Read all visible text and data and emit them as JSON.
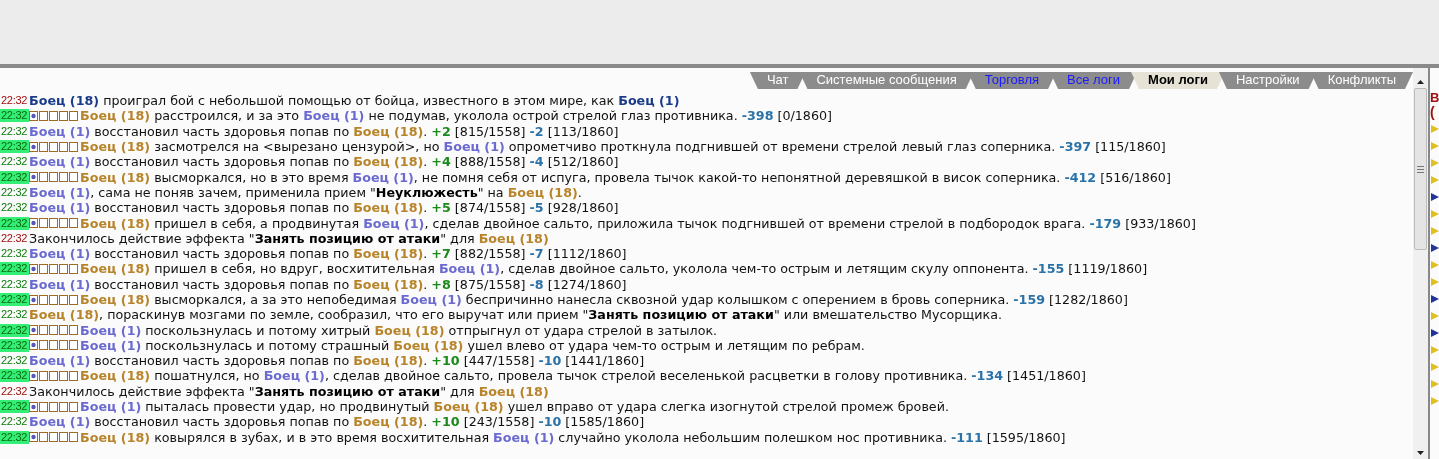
{
  "tabs": [
    {
      "label": "Чат",
      "selected": false,
      "highlighted": false
    },
    {
      "label": "Системные сообщения",
      "selected": false,
      "highlighted": false
    },
    {
      "label": "Торговля",
      "selected": false,
      "highlighted": true
    },
    {
      "label": "Все логи",
      "selected": false,
      "highlighted": true
    },
    {
      "label": "Мои логи",
      "selected": true,
      "highlighted": false
    },
    {
      "label": "Настройки",
      "selected": false,
      "highlighted": false
    },
    {
      "label": "Конфликты",
      "selected": false,
      "highlighted": false
    }
  ],
  "log": [
    {
      "time": "22:32",
      "kind": "system",
      "parts": [
        {
          "kind": "winner",
          "text": "Боец (18)"
        },
        {
          "kind": "text",
          "text": " проиграл бой с небольшой помощью от бойца, известного в этом мире, как "
        },
        {
          "kind": "winner",
          "text": "Боец (1)"
        }
      ]
    },
    {
      "time": "22:32",
      "kind": "attack",
      "parts": [
        {
          "kind": "fighter2",
          "text": "Боец (18)"
        },
        {
          "kind": "text",
          "text": " расстроился, и за это "
        },
        {
          "kind": "fighter1",
          "text": "Боец (1)"
        },
        {
          "kind": "text",
          "text": " не подумав, уколола острой стрелой глаз противника. "
        },
        {
          "kind": "damage",
          "text": "-398"
        },
        {
          "kind": "text",
          "text": " [0/1860]"
        }
      ]
    },
    {
      "time": "22:32",
      "kind": "normal",
      "parts": [
        {
          "kind": "fighter1",
          "text": "Боец (1)"
        },
        {
          "kind": "text",
          "text": " восстановил часть здоровья попав по "
        },
        {
          "kind": "fighter2",
          "text": "Боец (18)"
        },
        {
          "kind": "text",
          "text": ". "
        },
        {
          "kind": "heal",
          "text": "+2"
        },
        {
          "kind": "text",
          "text": " [815/1558] "
        },
        {
          "kind": "damage",
          "text": "-2"
        },
        {
          "kind": "text",
          "text": " [113/1860]"
        }
      ]
    },
    {
      "time": "22:32",
      "kind": "attack",
      "parts": [
        {
          "kind": "fighter2",
          "text": "Боец (18)"
        },
        {
          "kind": "text",
          "text": " засмотрелся на <вырезано цензурой>, но "
        },
        {
          "kind": "fighter1",
          "text": "Боец (1)"
        },
        {
          "kind": "text",
          "text": " опрометчиво проткнула подгнившей от времени стрелой левый глаз соперника. "
        },
        {
          "kind": "damage",
          "text": "-397"
        },
        {
          "kind": "text",
          "text": " [115/1860]"
        }
      ]
    },
    {
      "time": "22:32",
      "kind": "normal",
      "parts": [
        {
          "kind": "fighter1",
          "text": "Боец (1)"
        },
        {
          "kind": "text",
          "text": " восстановил часть здоровья попав по "
        },
        {
          "kind": "fighter2",
          "text": "Боец (18)"
        },
        {
          "kind": "text",
          "text": ". "
        },
        {
          "kind": "heal",
          "text": "+4"
        },
        {
          "kind": "text",
          "text": " [888/1558] "
        },
        {
          "kind": "damage",
          "text": "-4"
        },
        {
          "kind": "text",
          "text": " [512/1860]"
        }
      ]
    },
    {
      "time": "22:32",
      "kind": "attack",
      "parts": [
        {
          "kind": "fighter2",
          "text": "Боец (18)"
        },
        {
          "kind": "text",
          "text": " высморкался, но в это время "
        },
        {
          "kind": "fighter1",
          "text": "Боец (1)"
        },
        {
          "kind": "text",
          "text": ", не помня себя от испуга, провела тычок какой-то непонятной деревяшкой в висок соперника. "
        },
        {
          "kind": "damage",
          "text": "-412"
        },
        {
          "kind": "text",
          "text": " [516/1860]"
        }
      ]
    },
    {
      "time": "22:32",
      "kind": "normal",
      "parts": [
        {
          "kind": "fighter1",
          "text": "Боец (1)"
        },
        {
          "kind": "text",
          "text": ", сама не поняв зачем, применила прием \""
        },
        {
          "kind": "emph",
          "text": "Неуклюжесть"
        },
        {
          "kind": "text",
          "text": "\" на "
        },
        {
          "kind": "fighter2",
          "text": "Боец (18)"
        },
        {
          "kind": "text",
          "text": "."
        }
      ]
    },
    {
      "time": "22:32",
      "kind": "normal",
      "parts": [
        {
          "kind": "fighter1",
          "text": "Боец (1)"
        },
        {
          "kind": "text",
          "text": " восстановил часть здоровья попав по "
        },
        {
          "kind": "fighter2",
          "text": "Боец (18)"
        },
        {
          "kind": "text",
          "text": ". "
        },
        {
          "kind": "heal",
          "text": "+5"
        },
        {
          "kind": "text",
          "text": " [874/1558] "
        },
        {
          "kind": "damage",
          "text": "-5"
        },
        {
          "kind": "text",
          "text": " [928/1860]"
        }
      ]
    },
    {
      "time": "22:32",
      "kind": "attack",
      "parts": [
        {
          "kind": "fighter2",
          "text": "Боец (18)"
        },
        {
          "kind": "text",
          "text": " пришел в себя, а продвинутая "
        },
        {
          "kind": "fighter1",
          "text": "Боец (1)"
        },
        {
          "kind": "text",
          "text": ", сделав двойное сальто, приложила тычок подгнившей от времени стрелой в подбородок врага. "
        },
        {
          "kind": "damage",
          "text": "-179"
        },
        {
          "kind": "text",
          "text": " [933/1860]"
        }
      ]
    },
    {
      "time": "22:32",
      "kind": "system",
      "parts": [
        {
          "kind": "text",
          "text": "Закончилось действие эффекта \""
        },
        {
          "kind": "emph",
          "text": "Занять позицию от атаки"
        },
        {
          "kind": "text",
          "text": "\" для "
        },
        {
          "kind": "fighter2",
          "text": "Боец (18)"
        }
      ]
    },
    {
      "time": "22:32",
      "kind": "normal",
      "parts": [
        {
          "kind": "fighter1",
          "text": "Боец (1)"
        },
        {
          "kind": "text",
          "text": " восстановил часть здоровья попав по "
        },
        {
          "kind": "fighter2",
          "text": "Боец (18)"
        },
        {
          "kind": "text",
          "text": ". "
        },
        {
          "kind": "heal",
          "text": "+7"
        },
        {
          "kind": "text",
          "text": " [882/1558] "
        },
        {
          "kind": "damage",
          "text": "-7"
        },
        {
          "kind": "text",
          "text": " [1112/1860]"
        }
      ]
    },
    {
      "time": "22:32",
      "kind": "attack",
      "parts": [
        {
          "kind": "fighter2",
          "text": "Боец (18)"
        },
        {
          "kind": "text",
          "text": " пришел в себя, но вдруг, восхитительная "
        },
        {
          "kind": "fighter1",
          "text": "Боец (1)"
        },
        {
          "kind": "text",
          "text": ", сделав двойное сальто, уколола чем-то острым и летящим скулу оппонента. "
        },
        {
          "kind": "damage",
          "text": "-155"
        },
        {
          "kind": "text",
          "text": " [1119/1860]"
        }
      ]
    },
    {
      "time": "22:32",
      "kind": "normal",
      "parts": [
        {
          "kind": "fighter1",
          "text": "Боец (1)"
        },
        {
          "kind": "text",
          "text": " восстановил часть здоровья попав по "
        },
        {
          "kind": "fighter2",
          "text": "Боец (18)"
        },
        {
          "kind": "text",
          "text": ". "
        },
        {
          "kind": "heal",
          "text": "+8"
        },
        {
          "kind": "text",
          "text": " [875/1558] "
        },
        {
          "kind": "damage",
          "text": "-8"
        },
        {
          "kind": "text",
          "text": " [1274/1860]"
        }
      ]
    },
    {
      "time": "22:32",
      "kind": "attack",
      "parts": [
        {
          "kind": "fighter2",
          "text": "Боец (18)"
        },
        {
          "kind": "text",
          "text": " высморкался, а за это непобедимая "
        },
        {
          "kind": "fighter1",
          "text": "Боец (1)"
        },
        {
          "kind": "text",
          "text": " беспричинно нанесла сквозной удар колышком с оперением в бровь соперника. "
        },
        {
          "kind": "damage",
          "text": "-159"
        },
        {
          "kind": "text",
          "text": " [1282/1860]"
        }
      ]
    },
    {
      "time": "22:32",
      "kind": "normal",
      "parts": [
        {
          "kind": "fighter2",
          "text": "Боец (18)"
        },
        {
          "kind": "text",
          "text": ", пораскинув мозгами по земле, сообразил, что его выручат или прием \""
        },
        {
          "kind": "emph",
          "text": "Занять позицию от атаки"
        },
        {
          "kind": "text",
          "text": "\" или вмешательство Мусорщика."
        }
      ]
    },
    {
      "time": "22:32",
      "kind": "attack",
      "parts": [
        {
          "kind": "fighter1",
          "text": "Боец (1)"
        },
        {
          "kind": "text",
          "text": " поскользнулась и потому хитрый "
        },
        {
          "kind": "fighter2",
          "text": "Боец (18)"
        },
        {
          "kind": "text",
          "text": " отпрыгнул от удара стрелой в затылок."
        }
      ]
    },
    {
      "time": "22:32",
      "kind": "attack",
      "parts": [
        {
          "kind": "fighter1",
          "text": "Боец (1)"
        },
        {
          "kind": "text",
          "text": " поскользнулась и потому страшный "
        },
        {
          "kind": "fighter2",
          "text": "Боец (18)"
        },
        {
          "kind": "text",
          "text": " ушел влево от удара чем-то острым и летящим по ребрам."
        }
      ]
    },
    {
      "time": "22:32",
      "kind": "normal",
      "parts": [
        {
          "kind": "fighter1",
          "text": "Боец (1)"
        },
        {
          "kind": "text",
          "text": " восстановил часть здоровья попав по "
        },
        {
          "kind": "fighter2",
          "text": "Боец (18)"
        },
        {
          "kind": "text",
          "text": ". "
        },
        {
          "kind": "heal",
          "text": "+10"
        },
        {
          "kind": "text",
          "text": " [447/1558] "
        },
        {
          "kind": "damage",
          "text": "-10"
        },
        {
          "kind": "text",
          "text": " [1441/1860]"
        }
      ]
    },
    {
      "time": "22:32",
      "kind": "attack",
      "parts": [
        {
          "kind": "fighter2",
          "text": "Боец (18)"
        },
        {
          "kind": "text",
          "text": " пошатнулся, но "
        },
        {
          "kind": "fighter1",
          "text": "Боец (1)"
        },
        {
          "kind": "text",
          "text": ", сделав двойное сальто, провела тычок стрелой веселенькой расцветки в голову противника. "
        },
        {
          "kind": "damage",
          "text": "-134"
        },
        {
          "kind": "text",
          "text": " [1451/1860]"
        }
      ]
    },
    {
      "time": "22:32",
      "kind": "system",
      "parts": [
        {
          "kind": "text",
          "text": "Закончилось действие эффекта \""
        },
        {
          "kind": "emph",
          "text": "Занять позицию от атаки"
        },
        {
          "kind": "text",
          "text": "\" для "
        },
        {
          "kind": "fighter2",
          "text": "Боец (18)"
        }
      ]
    },
    {
      "time": "22:32",
      "kind": "attack",
      "parts": [
        {
          "kind": "fighter1",
          "text": "Боец (1)"
        },
        {
          "kind": "text",
          "text": " пыталась провести удар, но продвинутый "
        },
        {
          "kind": "fighter2",
          "text": "Боец (18)"
        },
        {
          "kind": "text",
          "text": " ушел вправо от удара слегка изогнутой стрелой промеж бровей."
        }
      ]
    },
    {
      "time": "22:32",
      "kind": "normal",
      "parts": [
        {
          "kind": "fighter1",
          "text": "Боец (1)"
        },
        {
          "kind": "text",
          "text": " восстановил часть здоровья попав по "
        },
        {
          "kind": "fighter2",
          "text": "Боец (18)"
        },
        {
          "kind": "text",
          "text": ". "
        },
        {
          "kind": "heal",
          "text": "+10"
        },
        {
          "kind": "text",
          "text": " [243/1558] "
        },
        {
          "kind": "damage",
          "text": "-10"
        },
        {
          "kind": "text",
          "text": " [1585/1860]"
        }
      ]
    },
    {
      "time": "22:32",
      "kind": "attack",
      "parts": [
        {
          "kind": "fighter2",
          "text": "Боец (18)"
        },
        {
          "kind": "text",
          "text": " ковырялся в зубах, и в это время восхитительная "
        },
        {
          "kind": "fighter1",
          "text": "Боец (1)"
        },
        {
          "kind": "text",
          "text": " случайно уколола небольшим полешком нос противника. "
        },
        {
          "kind": "damage",
          "text": "-111"
        },
        {
          "kind": "text",
          "text": " [1595/1860]"
        }
      ]
    }
  ],
  "side_panel": {
    "heading": "В",
    "subheading": "(",
    "icons": [
      {
        "color": "#e0c020"
      },
      {
        "color": "#e0c020"
      },
      {
        "color": "#e0c020"
      },
      {
        "color": "#e0c020"
      },
      {
        "color": "#223399"
      },
      {
        "color": "#e0c020"
      },
      {
        "color": "#e0c020"
      },
      {
        "color": "#223399"
      },
      {
        "color": "#e0c020"
      },
      {
        "color": "#e0c020"
      },
      {
        "color": "#223399"
      },
      {
        "color": "#e0c020"
      },
      {
        "color": "#223399"
      },
      {
        "color": "#e0c020"
      },
      {
        "color": "#e0c020"
      },
      {
        "color": "#e0c020"
      },
      {
        "color": "#e0c020"
      }
    ]
  }
}
